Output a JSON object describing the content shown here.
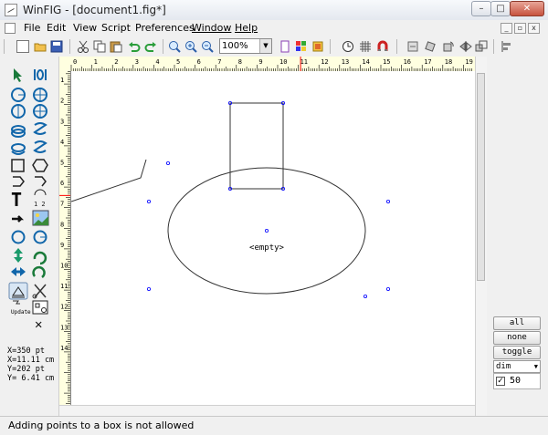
{
  "window": {
    "title": "WinFIG - [document1.fig*]",
    "minimize_glyph": "–",
    "maximize_glyph": "□",
    "close_glyph": "✕"
  },
  "menu": {
    "items": [
      "File",
      "Edit",
      "View",
      "Script",
      "Preferences",
      "Window",
      "Help"
    ]
  },
  "toolbar": {
    "zoom_value": "100%"
  },
  "rulers": {
    "horizontal_labels": [
      "0",
      "1",
      "2",
      "3",
      "4",
      "5",
      "6",
      "7",
      "8",
      "9",
      "10",
      "11",
      "12",
      "13",
      "14",
      "15",
      "16",
      "17",
      "18",
      "19"
    ],
    "vertical_labels": [
      "1",
      "2",
      "3",
      "4",
      "5",
      "6",
      "7",
      "8",
      "9",
      "10",
      "11",
      "12",
      "13",
      "14"
    ]
  },
  "palette": {
    "text_tool_glyph": "T",
    "update_label": "Update",
    "delete_glyph": "✕"
  },
  "coords": {
    "x_pt": "X=350 pt",
    "x_cm": "X=11.11 cm",
    "y_pt": "Y=202 pt",
    "y_cm": "Y= 6.41 cm"
  },
  "canvas": {
    "ellipse_label": "<empty>"
  },
  "right_panel": {
    "all_label": "all",
    "none_label": "none",
    "toggle_label": "toggle",
    "depth_mode": "dim",
    "layer_checked": "✓",
    "layer_depth": "50"
  },
  "status": {
    "message": "Adding points to a box is not allowed"
  },
  "colors": {
    "ruler_background": "#ffffe0",
    "marker_point": "#0000ff",
    "ruler_indicator": "#ff0000"
  }
}
